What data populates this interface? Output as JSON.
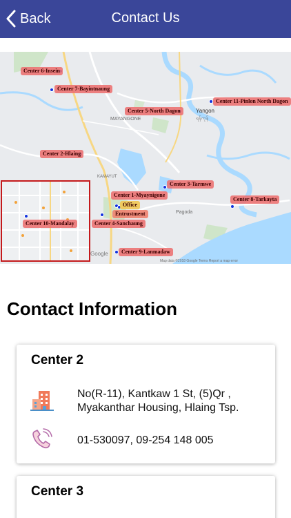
{
  "nav": {
    "back_label": "Back",
    "title": "Contact Us"
  },
  "map": {
    "labels": {
      "center6": "Center 6-Insein",
      "center7": "Center 7-Bayintnaung",
      "center5": "Center 5-North Dagon",
      "center11": "Center 11-Pinlon North Dagon",
      "center2": "Center 2-Hlaing",
      "center1": "Center 1-Myaynigone",
      "center3": "Center 3-Tarmwe",
      "center8": "Center 8-Tarkayta",
      "office": "Office",
      "entrust": "Entrustment",
      "center4": "Center 4-Sanchaung",
      "center10": "Center 10-Mandalay",
      "center9": "Center 9-Lanmadaw"
    },
    "place_names": {
      "yangon": "Yangon",
      "yangon_mm": "ရန်ကုန်",
      "mayangone": "MAYANGONE",
      "kamaryut": "KAMAYUT",
      "pagoda": "Pagoda",
      "google": "Google",
      "attribution": "Map data ©2018 Google  Terms  Report a map error"
    }
  },
  "contact": {
    "heading": "Contact Information",
    "cards": [
      {
        "title": "Center 2",
        "address_line1": "No(R-11), Kantkaw 1 St, (5)Qr ,",
        "address_line2": "Myakanthar Housing, Hlaing Tsp.",
        "phone": "01-530097,  09-254 148 005"
      },
      {
        "title": "Center 3"
      }
    ]
  },
  "colors": {
    "nav_bg": "#3a4699",
    "label_bg": "#ec7070",
    "pin": "#1233dd",
    "inset_border": "#c4191b"
  },
  "icons": {
    "back": "chevron-left-icon",
    "building": "building-icon",
    "phone": "phone-icon"
  }
}
